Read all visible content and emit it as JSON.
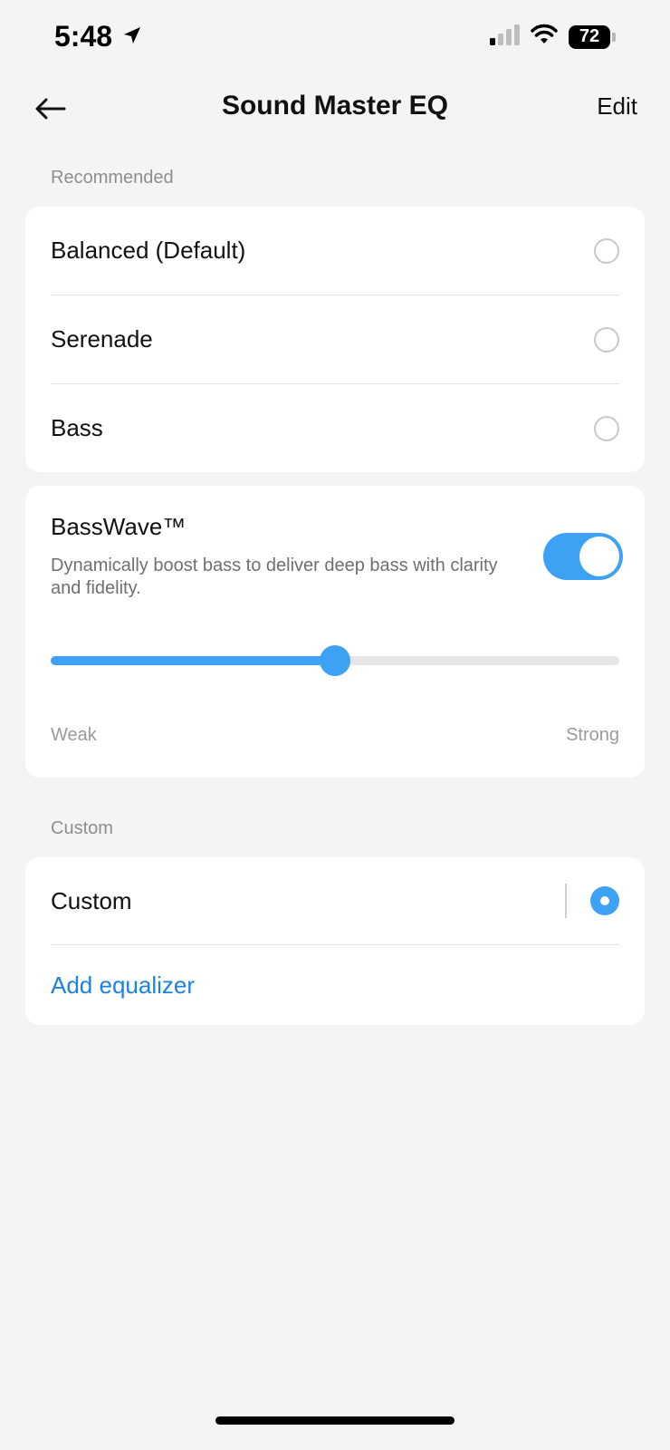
{
  "status_bar": {
    "time": "5:48",
    "battery": "72",
    "icons": [
      "location-arrow-icon",
      "signal-icon",
      "wifi-icon",
      "battery-icon"
    ]
  },
  "nav": {
    "title": "Sound Master EQ",
    "edit_label": "Edit",
    "back_icon": "back-arrow-icon"
  },
  "recommended": {
    "section_label": "Recommended",
    "items": [
      {
        "label": "Balanced (Default)",
        "selected": false
      },
      {
        "label": "Serenade",
        "selected": false
      },
      {
        "label": "Bass",
        "selected": false
      }
    ]
  },
  "basswave": {
    "title": "BassWave™",
    "description": "Dynamically boost bass to deliver deep bass with clarity and fidelity.",
    "enabled": true,
    "level": 0.5,
    "min_label": "Weak",
    "max_label": "Strong"
  },
  "custom": {
    "section_label": "Custom",
    "items": [
      {
        "label": "Custom",
        "selected": true
      }
    ],
    "add_label": "Add equalizer"
  },
  "colors": {
    "accent": "#3ea2f4",
    "link": "#1c82e3",
    "background": "#f4f4f4"
  }
}
